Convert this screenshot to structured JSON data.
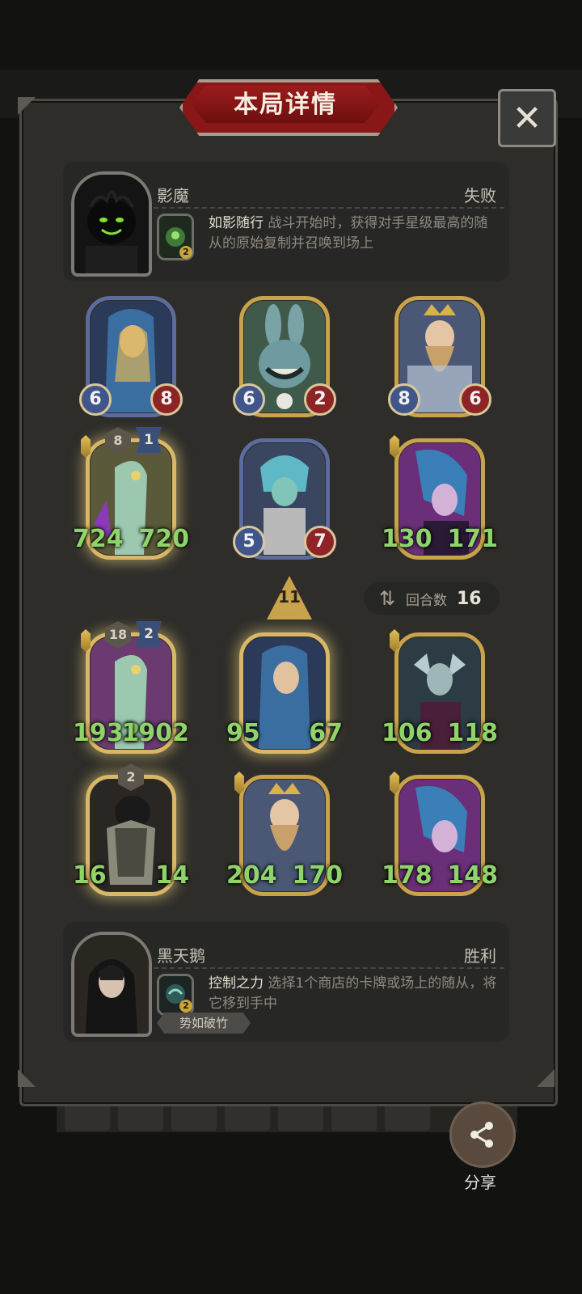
{
  "title": "本局详情",
  "close_icon": "close-icon",
  "opponent": {
    "name": "影魔",
    "result": "失败",
    "skill_name": "如影随行",
    "skill_desc": "战斗开始时，获得对手星级最高的随从的原始复制并召唤到场上",
    "skill_level": "2"
  },
  "opponent_cards": [
    {
      "atk": "6",
      "hp": "8"
    },
    {
      "atk": "6",
      "hp": "2"
    },
    {
      "atk": "8",
      "hp": "6"
    },
    {
      "atk": "724",
      "hp": "720",
      "star": "8",
      "level": "1"
    },
    {
      "atk": "5",
      "hp": "7"
    },
    {
      "atk": "130",
      "hp": "171"
    }
  ],
  "turn_marker": "11",
  "round": {
    "label": "回合数",
    "value": "16"
  },
  "player_cards": [
    {
      "atk": "1932",
      "hp": "1902",
      "star": "18",
      "level": "2"
    },
    {
      "atk": "95",
      "hp": "67"
    },
    {
      "atk": "106",
      "hp": "118"
    },
    {
      "atk": "16",
      "hp": "14",
      "star": "2"
    },
    {
      "atk": "204",
      "hp": "170"
    },
    {
      "atk": "178",
      "hp": "148"
    }
  ],
  "player": {
    "name": "黑天鹅",
    "result": "胜利",
    "skill_name": "控制之力",
    "skill_desc": "选择1个商店的卡牌或场上的随从，将它移到手中",
    "skill_level": "2",
    "tag": "势如破竹"
  },
  "share": {
    "label": "分享"
  },
  "colors": {
    "accent_red": "#8a1717",
    "gold": "#c9a24c",
    "stat_green": "#8fd46a"
  }
}
